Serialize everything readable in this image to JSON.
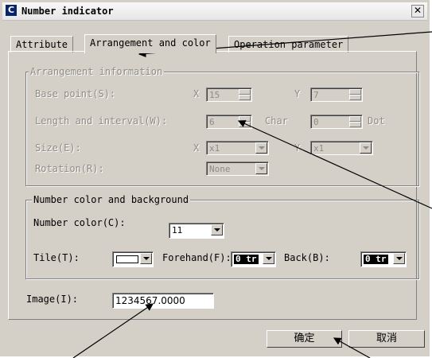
{
  "window": {
    "title": "Number indicator",
    "close_glyph": "✕",
    "icon_letter": "C"
  },
  "tabs": [
    {
      "label": "Attribute"
    },
    {
      "label": "Arrangement and color"
    },
    {
      "label": "Operation parameter"
    }
  ],
  "arrangement": {
    "legend": "Arrangement information",
    "base_point_label": "Base point(S):",
    "x_label": "X",
    "y_label": "Y",
    "base_x": "15",
    "base_y": "7",
    "length_label": "Length and interval(W):",
    "length_value": "6",
    "char_label": "Char",
    "interval_value": "0",
    "dot_label": "Dot",
    "size_label": "Size(E):",
    "size_x": "x1",
    "size_y": "x1",
    "rotation_label": "Rotation(R):",
    "rotation_value": "None"
  },
  "color": {
    "legend": "Number color and background",
    "number_color_label": "Number color(C):",
    "number_color_value": "11",
    "tile_label": "Tile(T):",
    "forehand_label": "Forehand(F):",
    "forehand_value": "0 tr",
    "back_label": "Back(B):",
    "back_value": "0 tr"
  },
  "image": {
    "label": "Image(I):",
    "value": "1234567.0000"
  },
  "buttons": {
    "ok": "确定",
    "cancel": "取消"
  }
}
